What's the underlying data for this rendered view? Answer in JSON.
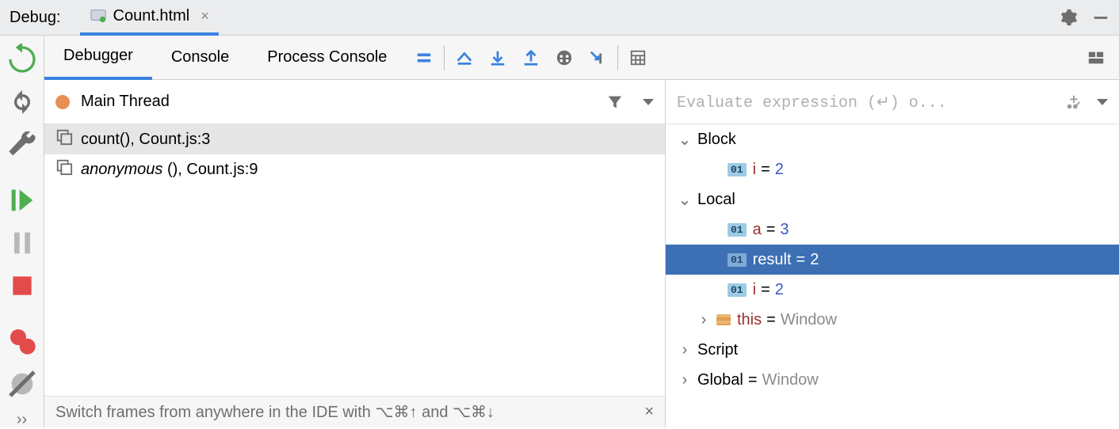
{
  "header": {
    "title": "Debug:",
    "file": "Count.html"
  },
  "toolbar": {
    "tabs": {
      "debugger": "Debugger",
      "console": "Console",
      "process": "Process Console"
    }
  },
  "frames_panel": {
    "thread": "Main Thread",
    "frames": [
      {
        "func": "count()",
        "loc": "Count.js:3",
        "italic": false,
        "selected": true
      },
      {
        "func": "anonymous",
        "paren": "()",
        "loc": "Count.js:9",
        "italic": true,
        "selected": false
      }
    ],
    "hint": "Switch frames from anywhere in the IDE with ⌥⌘↑ and ⌥⌘↓"
  },
  "vars_panel": {
    "eval_placeholder": "Evaluate expression (↵) o...",
    "scopes": [
      {
        "name": "Block",
        "expanded": true,
        "vars": [
          {
            "badge": "01",
            "name": "i",
            "nameColor": "red",
            "value": "2",
            "valColor": "blue",
            "selected": false
          }
        ]
      },
      {
        "name": "Local",
        "expanded": true,
        "vars": [
          {
            "badge": "01",
            "name": "a",
            "nameColor": "red",
            "value": "3",
            "valColor": "blue",
            "selected": false
          },
          {
            "badge": "01",
            "name": "result",
            "nameColor": "white",
            "value": "2",
            "valColor": "white",
            "selected": true
          },
          {
            "badge": "01",
            "name": "i",
            "nameColor": "red",
            "value": "2",
            "valColor": "blue",
            "selected": false
          },
          {
            "badge": "obj",
            "name": "this",
            "nameColor": "red",
            "value": "Window",
            "valColor": "gray",
            "expandable": true,
            "selected": false
          }
        ]
      },
      {
        "name": "Script",
        "expanded": false,
        "vars": []
      },
      {
        "name": "Global",
        "value": "Window",
        "expanded": false,
        "vars": []
      }
    ]
  }
}
